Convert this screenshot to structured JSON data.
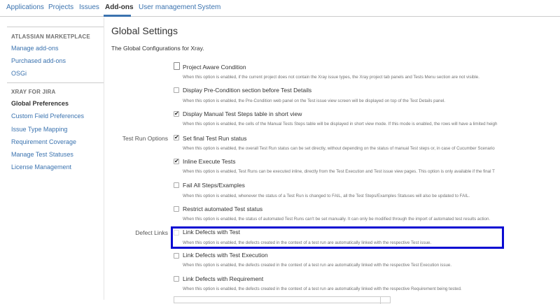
{
  "nav": {
    "tabs": [
      "Applications",
      "Projects",
      "Issues",
      "Add-ons",
      "User management",
      "System"
    ]
  },
  "sidebar": {
    "marketplace_heading": "ATLASSIAN MARKETPLACE",
    "marketplace_items": [
      "Manage add-ons",
      "Purchased add-ons",
      "OSGi"
    ],
    "xray_heading": "XRAY FOR JIRA",
    "xray_items": [
      "Global Preferences",
      "Custom Field Preferences",
      "Issue Type Mapping",
      "Requirement Coverage",
      "Manage Test Statuses",
      "License Management"
    ]
  },
  "main": {
    "title": "Global Settings",
    "description": "The Global Configurations for Xray."
  },
  "groups": {
    "test_run_options": "Test Run Options",
    "defect_links": "Defect Links"
  },
  "options": [
    {
      "label": "Project Aware Condition",
      "checked": false,
      "description": "When this option is enabled, if the current project does not contain the Xray issue types, the Xray project tab panels and Tests Menu section are not visible."
    },
    {
      "label": "Display Pre-Condition section before Test Details",
      "checked": false,
      "description": "When this option is enabled, the Pre-Condition web panel on the Test issue view screen will be displayed on top of the Test Details panel."
    },
    {
      "label": "Display Manual Test Steps table in short view",
      "checked": true,
      "description": "When this option is enabled, the cells of the Manual Tests Steps table will be displayed in short view mode. If this mode is enabled, the rows will have a limited heigh"
    },
    {
      "label": "Set final Test Run status",
      "checked": true,
      "description": "When this option is enabled, the overall Test Run status can be set directly, without depending on the status of manual Test steps or, in case of Cucumber Scenario"
    },
    {
      "label": "Inline Execute Tests",
      "checked": true,
      "description": "When this option is enabled, Test Runs can be executed inline, directly from the Test Execution and Test issue view pages. This option is only available if the final T"
    },
    {
      "label": "Fail All Steps/Examples",
      "checked": false,
      "description": "When this option is enabled, whenever the status of a Test Run is changed to FAIL, all the Test Steps/Examples Statuses will also be updated to FAIL."
    },
    {
      "label": "Restrict automated Test status",
      "checked": false,
      "description": "When this option is enabled, the status of automated Test Runs can't be set manually. It can only be modified through the import of automated test results action."
    },
    {
      "label": "Link Defects with Test",
      "checked": false,
      "description": "When this option is enabled, the defects created in the context of a test run are automatically linked with the respective Test issue."
    },
    {
      "label": "Link Defects with Test Execution",
      "checked": false,
      "description": "When this option is enabled, the defects created in the context of a test run are automatically linked with the respective Test Execution issue."
    },
    {
      "label": "Link Defects with Requirement",
      "checked": false,
      "description": "When this option is enabled, the defects created in the context of a test run are automatically linked with the respective Requirement being tested."
    }
  ]
}
